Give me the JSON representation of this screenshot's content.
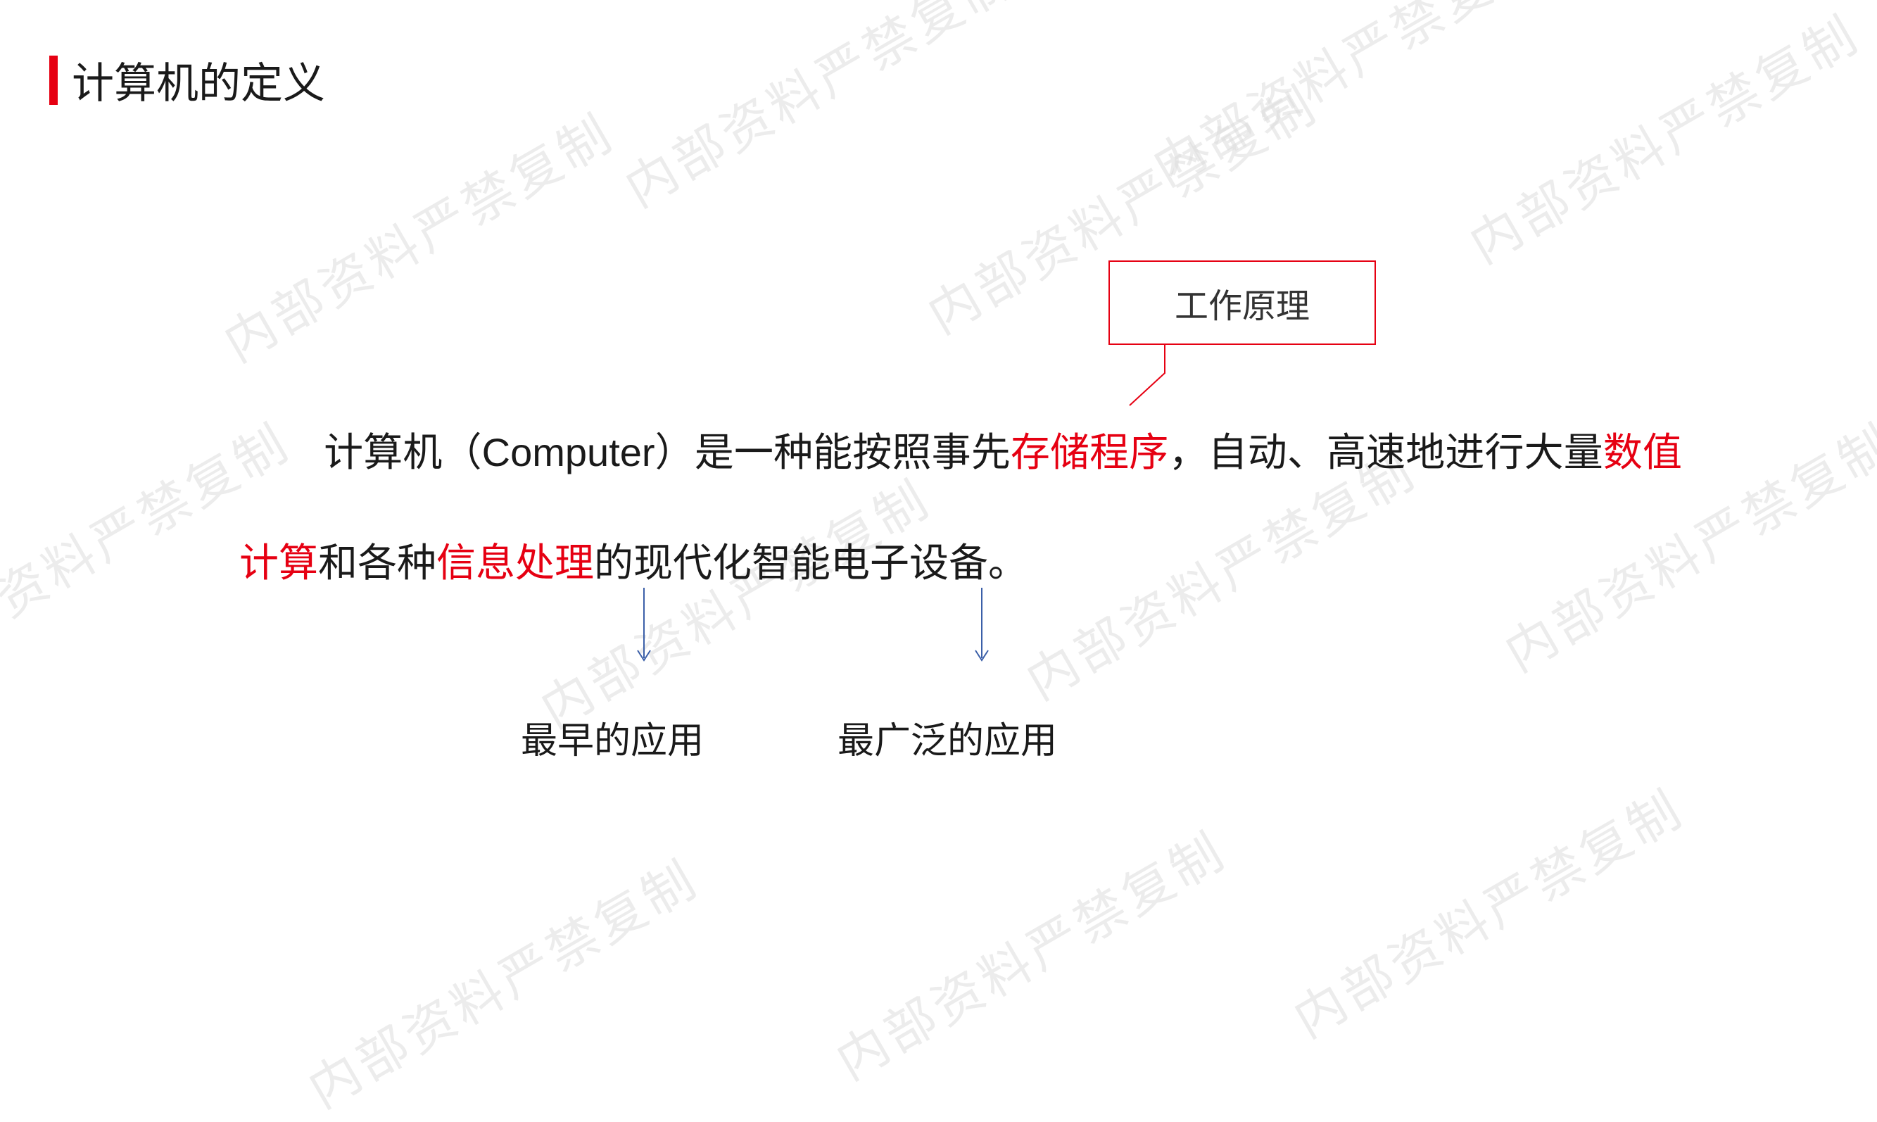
{
  "title": "计算机的定义",
  "callout": {
    "label": "工作原理"
  },
  "body": {
    "segments": {
      "s1": "计算机（Computer）是一种能按照事先",
      "h1": "存储程序",
      "s2": "，自动、高速地进行大量",
      "h2": "数值计算",
      "s3": "和各种",
      "h3": "信息处理",
      "s4": "的现代化智能电子设备。"
    }
  },
  "annotations": {
    "a1": "最早的应用",
    "a2": "最广泛的应用"
  },
  "watermark_text": "内部资料严禁复制"
}
